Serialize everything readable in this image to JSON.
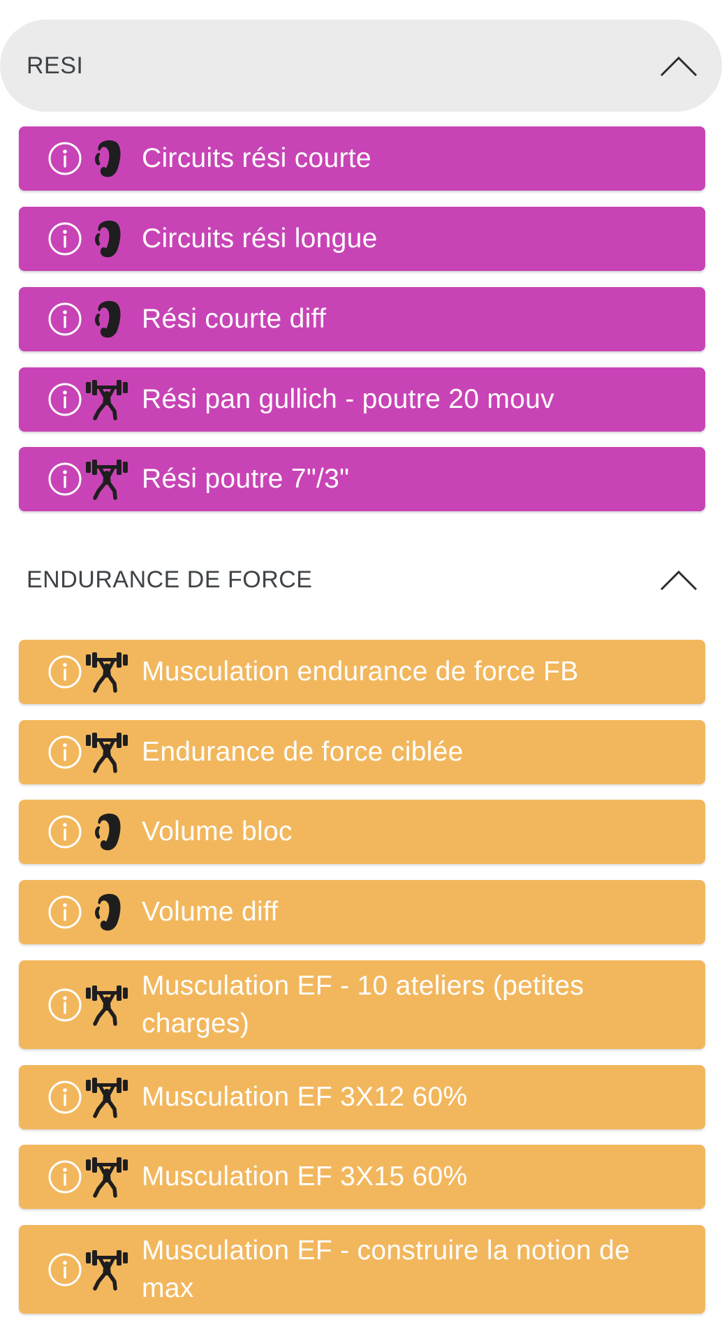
{
  "sections": [
    {
      "title": "RESI",
      "expanded": true,
      "color": "#c844b6",
      "items": [
        {
          "label": "Circuits rési courte",
          "icon": "climbing-hold-icon"
        },
        {
          "label": "Circuits rési longue",
          "icon": "climbing-hold-icon"
        },
        {
          "label": "Rési courte diff",
          "icon": "climbing-hold-icon"
        },
        {
          "label": "Rési pan gullich - poutre 20 mouv",
          "icon": "weightlifting-icon"
        },
        {
          "label": "Rési poutre 7\"/3\"",
          "icon": "weightlifting-icon"
        }
      ]
    },
    {
      "title": "ENDURANCE DE FORCE",
      "expanded": true,
      "color": "#f2b75d",
      "items": [
        {
          "label": "Musculation endurance de force FB",
          "icon": "weightlifting-icon"
        },
        {
          "label": "Endurance de force ciblée",
          "icon": "weightlifting-icon"
        },
        {
          "label": "Volume bloc",
          "icon": "climbing-hold-icon"
        },
        {
          "label": "Volume diff",
          "icon": "climbing-hold-icon"
        },
        {
          "label": "Musculation EF - 10 ateliers (petites charges)",
          "icon": "weightlifting-icon"
        },
        {
          "label": "Musculation EF 3X12 60%",
          "icon": "weightlifting-icon"
        },
        {
          "label": "Musculation EF 3X15 60%",
          "icon": "weightlifting-icon"
        },
        {
          "label": "Musculation EF - construire la notion de max",
          "icon": "weightlifting-icon"
        }
      ]
    }
  ]
}
